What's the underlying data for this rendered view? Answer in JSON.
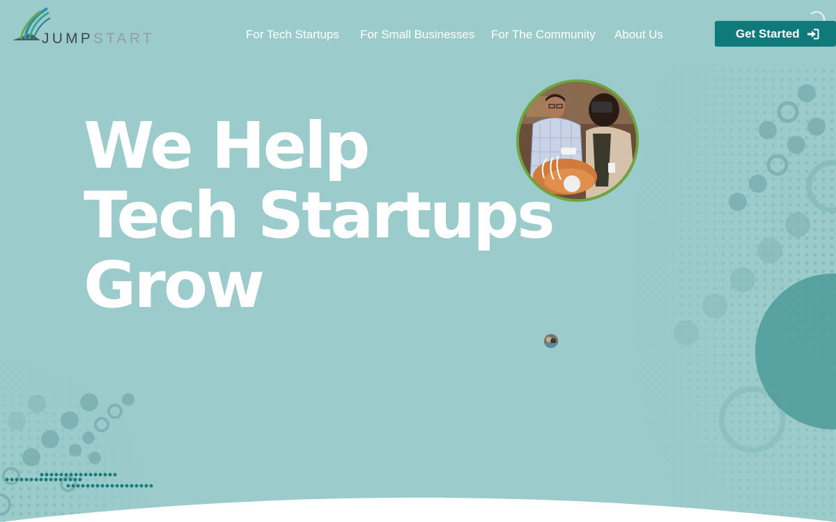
{
  "brand": {
    "logo_text_part1": "JUMP",
    "logo_text_part2": "START",
    "primary_color": "#107a7a",
    "background_color": "#9ccbcb",
    "text_color": "#ffffff"
  },
  "nav": {
    "items": [
      {
        "label": "For Tech Startups"
      },
      {
        "label": "For Small Businesses"
      },
      {
        "label": "For The Community"
      },
      {
        "label": "About Us"
      }
    ]
  },
  "cta": {
    "label": "Get Started",
    "icon": "sign-in-icon"
  },
  "hero": {
    "title_lines": [
      "We Help",
      "Tech Startups",
      "Grow"
    ],
    "photo_icon": "hero-photo",
    "avatar_icon": "mini-avatar"
  }
}
